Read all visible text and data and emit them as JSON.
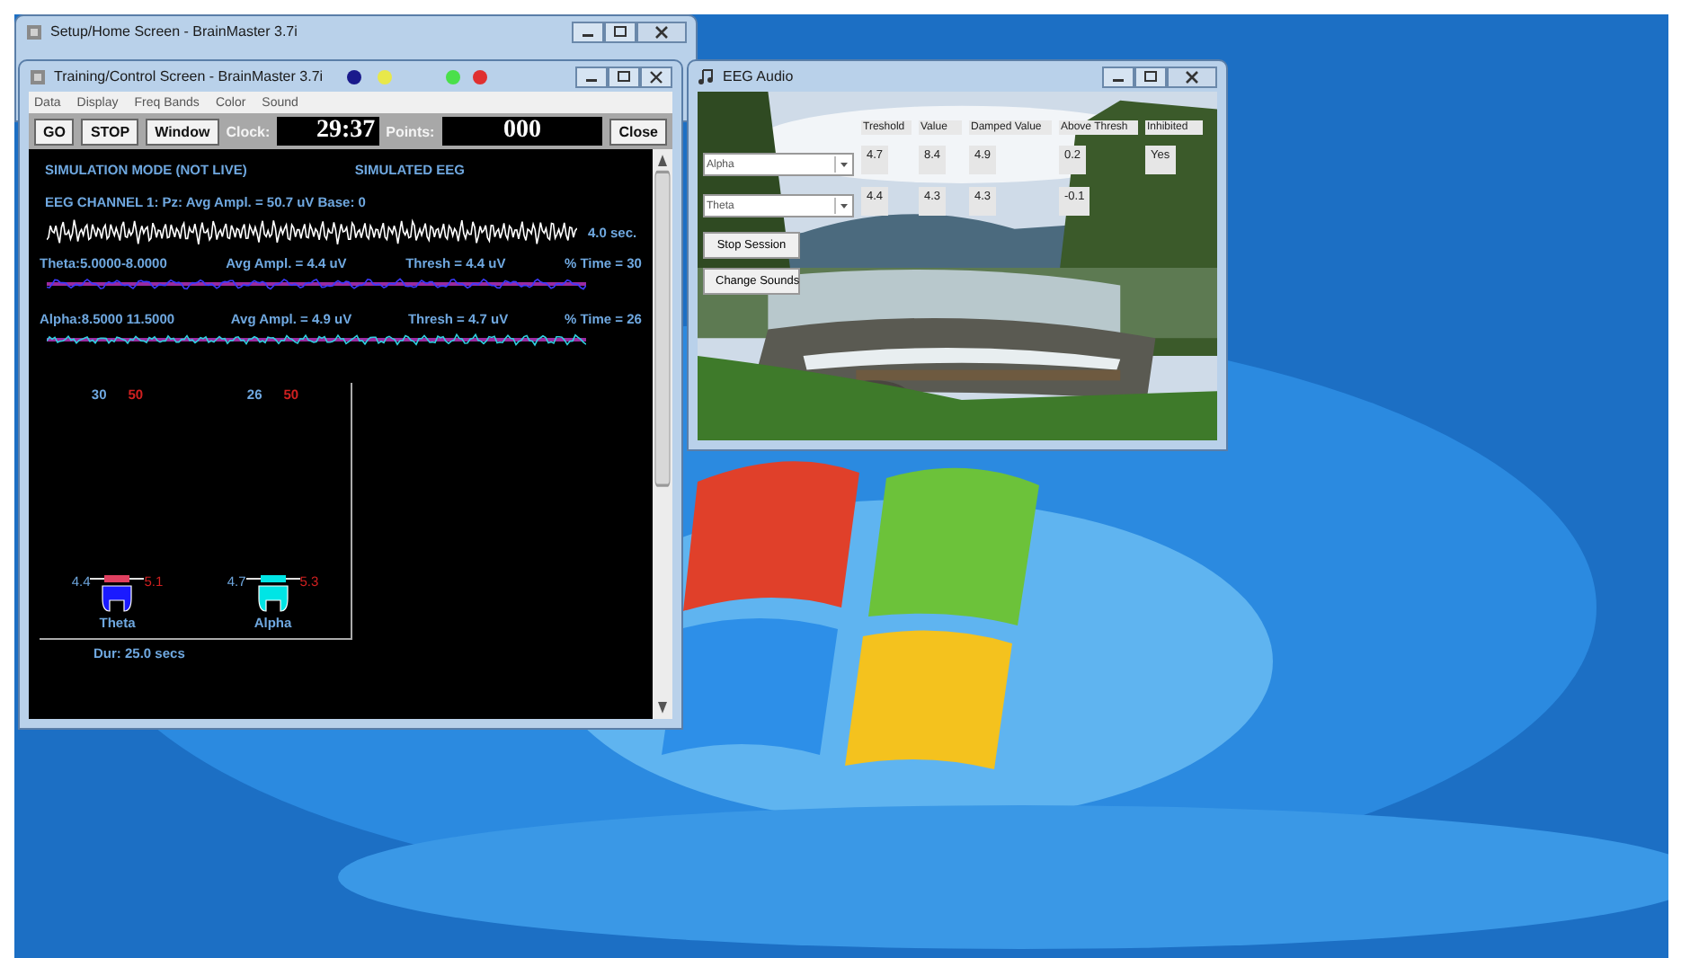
{
  "home_window": {
    "title": "Setup/Home Screen - BrainMaster 3.7i"
  },
  "training_window": {
    "title": "Training/Control Screen - BrainMaster 3.7i",
    "menu": [
      "Data",
      "Display",
      "Freq Bands",
      "Color",
      "Sound"
    ],
    "toolbar": {
      "buttons": [
        "GO",
        "STOP",
        "Window"
      ],
      "clock_label": "Clock:",
      "clock": "29:37",
      "points_label": "Points:",
      "points": "000",
      "close": "Close"
    },
    "mode": "SIMULATION MODE (NOT LIVE)",
    "source": "SIMULATED EEG",
    "channel": "EEG CHANNEL 1: Pz: Avg Ampl. = 50.7 uV  Base: 0",
    "time_scale": "4.0 sec.",
    "bands": [
      {
        "name": "Theta:5.0000-8.0000",
        "avg": "Avg Ampl. = 4.4 uV",
        "thresh": "Thresh = 4.4 uV",
        "time": "% Time = 30",
        "color": "#3a3aff"
      },
      {
        "name": "Alpha:8.5000 11.5000",
        "avg": "Avg Ampl. = 4.9 uV",
        "thresh": "Thresh = 4.7 uV",
        "time": "% Time = 26",
        "color": "#30d0e0"
      }
    ],
    "gauges": [
      {
        "percent": "30",
        "target": "50",
        "value": "4.4",
        "limit": "5.1",
        "label": "Theta",
        "color": "#1a1aff"
      },
      {
        "percent": "26",
        "target": "50",
        "value": "4.7",
        "limit": "5.3",
        "label": "Alpha",
        "color": "#00e5e5"
      }
    ],
    "duration": "Dur: 25.0 secs"
  },
  "audio_window": {
    "title": "EEG Audio",
    "columns": [
      "Treshold",
      "Value",
      "Damped Value",
      "Above Thresh",
      "Inhibited"
    ],
    "rows": [
      {
        "band": "Alpha",
        "values": [
          "4.7",
          "8.4",
          "4.9",
          "0.2",
          "Yes"
        ]
      },
      {
        "band": "Theta",
        "values": [
          "4.4",
          "4.3",
          "4.3",
          "-0.1"
        ]
      }
    ],
    "buttons": [
      "Stop Session",
      "Change Sounds"
    ]
  }
}
